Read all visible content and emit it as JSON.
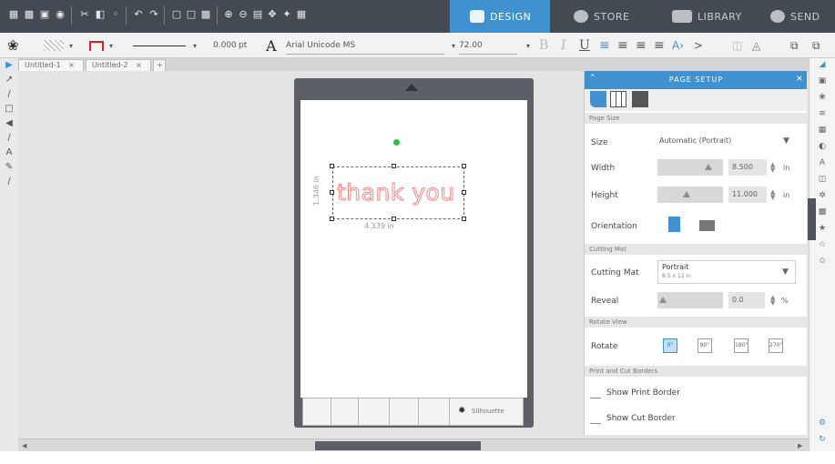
{
  "modes": {
    "design": "DESIGN",
    "store": "STORE",
    "library": "LIBRARY",
    "send": "SEND"
  },
  "toolbar": {
    "line_width": "0.000",
    "line_unit": "pt",
    "font_name": "Arial Unicode MS",
    "font_size": "72.00",
    "bold": "B",
    "italic": "I",
    "underline": "U"
  },
  "tabs": [
    {
      "label": "Untitled-1",
      "close": "×"
    },
    {
      "label": "Untitled-2",
      "close": "×"
    }
  ],
  "tab_add": "+",
  "design": {
    "text": "thank you",
    "width_label": "4.339 in",
    "height_label": "1.346 in"
  },
  "panel": {
    "title": "PAGE SETUP",
    "close": "×",
    "sections": {
      "page_size": "Page Size",
      "cutting_mat": "Cutting Mat",
      "rotate_view": "Rotate View",
      "borders": "Print and Cut Borders"
    },
    "size": {
      "label": "Size",
      "value": "Automatic (Portrait)"
    },
    "width": {
      "label": "Width",
      "value": "8.500",
      "unit": "in"
    },
    "height": {
      "label": "Height",
      "value": "11.000",
      "unit": "in"
    },
    "orientation": {
      "label": "Orientation"
    },
    "cutting_mat": {
      "label": "Cutting Mat",
      "value": "Portrait",
      "sub": "8.5 x 12 in"
    },
    "reveal": {
      "label": "Reveal",
      "value": "0.0",
      "unit": "%"
    },
    "rotate": {
      "label": "Rotate",
      "options": [
        "0°",
        "90°",
        "180°",
        "270°"
      ],
      "selected": 0
    },
    "show_print_border": "Show Print Border",
    "show_cut_border": "Show Cut Border"
  },
  "mat_strip_label": "Silhouette",
  "colors": {
    "topbar": "#444a52",
    "accent": "#3f91cf",
    "text_outline": "#ef8a8a",
    "handle_rotate": "#2fbf3f"
  }
}
